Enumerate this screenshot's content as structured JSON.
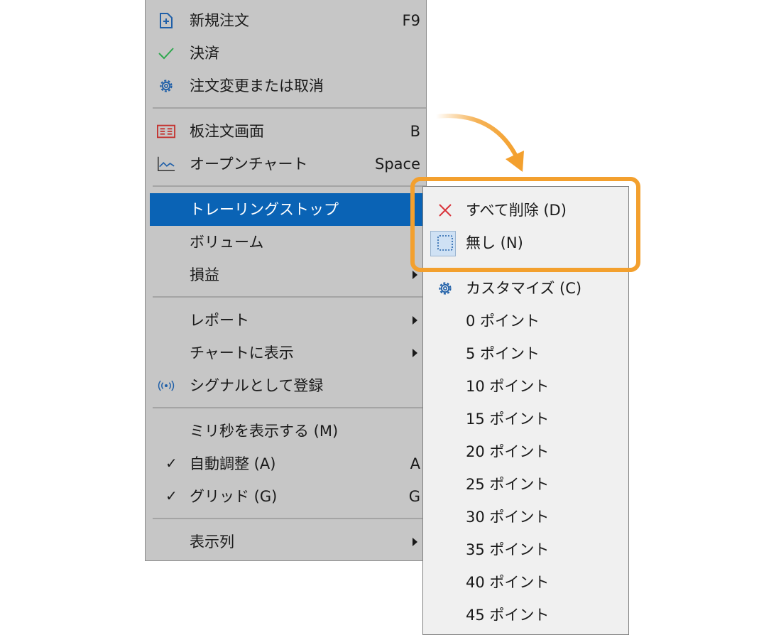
{
  "context_menu": {
    "items": [
      {
        "label": "新規注文",
        "shortcut": "F9",
        "icon": "new-order-icon"
      },
      {
        "label": "決済",
        "icon": "checkmark-icon"
      },
      {
        "label": "注文変更または取消",
        "icon": "gear-icon"
      },
      {
        "label": "板注文画面",
        "shortcut": "B",
        "icon": "order-board-icon"
      },
      {
        "label": "オープンチャート",
        "shortcut": "Space",
        "icon": "chart-icon"
      },
      {
        "label": "トレーリングストップ",
        "highlighted": true
      },
      {
        "label": "ボリューム"
      },
      {
        "label": "損益"
      },
      {
        "label": "レポート"
      },
      {
        "label": "チャートに表示"
      },
      {
        "label": "シグナルとして登録",
        "icon": "signal-icon"
      },
      {
        "label": "ミリ秒を表示する (M)"
      },
      {
        "label": "自動調整 (A)",
        "shortcut": "A",
        "checked": true
      },
      {
        "label": "グリッド (G)",
        "shortcut": "G",
        "checked": true
      },
      {
        "label": "表示列"
      }
    ],
    "check_mark": "✓"
  },
  "submenu": {
    "items": [
      {
        "label": "すべて削除 (D)",
        "icon": "close-x-icon"
      },
      {
        "label": "無し (N)",
        "icon": "dotted-square-icon",
        "selected": true
      },
      {
        "label": "カスタマイズ (C)",
        "icon": "gear-icon"
      },
      {
        "label": "0 ポイント"
      },
      {
        "label": "5 ポイント"
      },
      {
        "label": "10 ポイント"
      },
      {
        "label": "15 ポイント"
      },
      {
        "label": "20 ポイント"
      },
      {
        "label": "25 ポイント"
      },
      {
        "label": "30 ポイント"
      },
      {
        "label": "35 ポイント"
      },
      {
        "label": "40 ポイント"
      },
      {
        "label": "45 ポイント"
      }
    ]
  },
  "colors": {
    "highlight": "#0a63b5",
    "callout": "#f3a02e",
    "menu_bg": "#c6c6c6",
    "submenu_bg": "#f0f0f0"
  }
}
